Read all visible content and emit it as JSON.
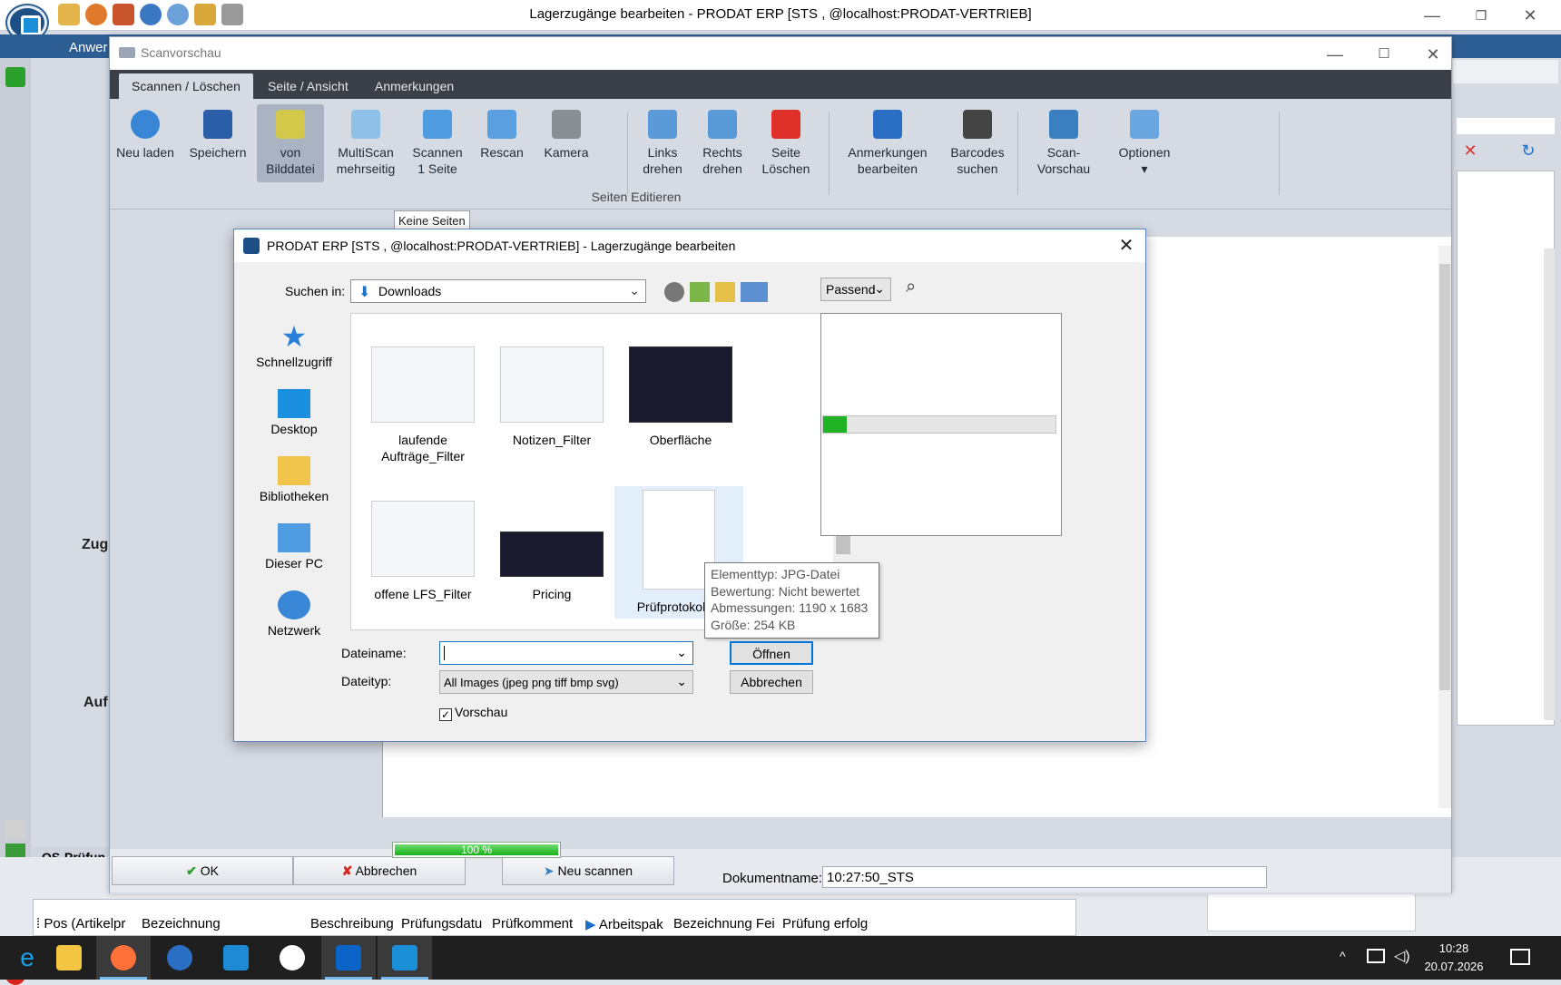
{
  "app": {
    "title": "Lagerzugänge bearbeiten - PRODAT ERP   [STS ,  @localhost:PRODAT-VERTRIEB]",
    "menu_partial": "Anwer",
    "label_zug": "Zug",
    "label_auf": "Auf",
    "qs_label": "QS-Prüfun"
  },
  "bottom_table": {
    "columns": [
      "Pos (Artikelpr",
      "Bezeichnung",
      "Beschreibung",
      "Prüfungsdatu",
      "Prüfkomment",
      "Arbeitspak",
      "Bezeichnung Fei",
      "Prüfung erfolg"
    ]
  },
  "scan": {
    "title": "Scanvorschau",
    "tabs": [
      "Scannen / Löschen",
      "Seite / Ansicht",
      "Anmerkungen"
    ],
    "ribbon": [
      {
        "l1": "Neu laden",
        "l2": "",
        "icon": "reload-icon"
      },
      {
        "l1": "Speichern",
        "l2": "",
        "icon": "save-icon"
      },
      {
        "l1": "von",
        "l2": "Bilddatei",
        "icon": "image-file-icon"
      },
      {
        "l1": "MultiScan",
        "l2": "mehrseitig",
        "icon": "multiscan-icon"
      },
      {
        "l1": "Scannen",
        "l2": "1 Seite",
        "icon": "scan-page-icon"
      },
      {
        "l1": "Rescan",
        "l2": "",
        "icon": "rescan-icon"
      },
      {
        "l1": "Kamera",
        "l2": "",
        "icon": "camera-icon"
      },
      {
        "l1": "Links",
        "l2": "drehen",
        "icon": "rotate-left-icon"
      },
      {
        "l1": "Rechts",
        "l2": "drehen",
        "icon": "rotate-right-icon"
      },
      {
        "l1": "Seite",
        "l2": "Löschen",
        "icon": "delete-page-icon"
      },
      {
        "l1": "Anmerkungen",
        "l2": "bearbeiten",
        "icon": "pen-icon"
      },
      {
        "l1": "Barcodes",
        "l2": "suchen",
        "icon": "barcode-icon"
      },
      {
        "l1": "Scan-",
        "l2": "Vorschau",
        "icon": "scan-preview-icon"
      },
      {
        "l1": "Optionen",
        "l2": "▾",
        "icon": "options-icon"
      }
    ],
    "group_label": "Seiten Editieren",
    "pages_tab": "Keine Seiten",
    "progress_text": "100 %",
    "progress_value": 1.0,
    "buttons": {
      "ok": "OK",
      "cancel": "Abbrechen",
      "rescan": "Neu scannen"
    },
    "docname_label": "Dokumentname:",
    "docname_value": "10:27:50_STS"
  },
  "dialog": {
    "title": "PRODAT ERP   [STS ,  @localhost:PRODAT-VERTRIEB] - Lagerzugänge bearbeiten",
    "lookin_label": "Suchen in:",
    "lookin_value": "Downloads",
    "places": [
      "Schnellzugriff",
      "Desktop",
      "Bibliotheken",
      "Dieser PC",
      "Netzwerk"
    ],
    "files": [
      {
        "name": "laufende Aufträge_Filter"
      },
      {
        "name": "Notizen_Filter"
      },
      {
        "name": "Oberfläche"
      },
      {
        "name": "offene LFS_Filter"
      },
      {
        "name": "Pricing"
      },
      {
        "name": "Prüfprotokoll C"
      }
    ],
    "zoom_value": "Passend",
    "preview_progress": 0.1,
    "filename_label": "Dateiname:",
    "filename_value": "",
    "filetype_label": "Dateityp:",
    "filetype_value": "All Images (jpeg png tiff bmp svg)",
    "open_label": "Öffnen",
    "cancel_label": "Abbrechen",
    "preview_label": "Vorschau",
    "preview_checked": "✓",
    "tooltip": [
      "Elementtyp: JPG-Datei",
      "Bewertung: Nicht bewertet",
      "Abmessungen: 1190 x 1683",
      "Größe: 254 KB"
    ]
  },
  "taskbar": {
    "time": "10:28",
    "date": "20.07.2026"
  }
}
